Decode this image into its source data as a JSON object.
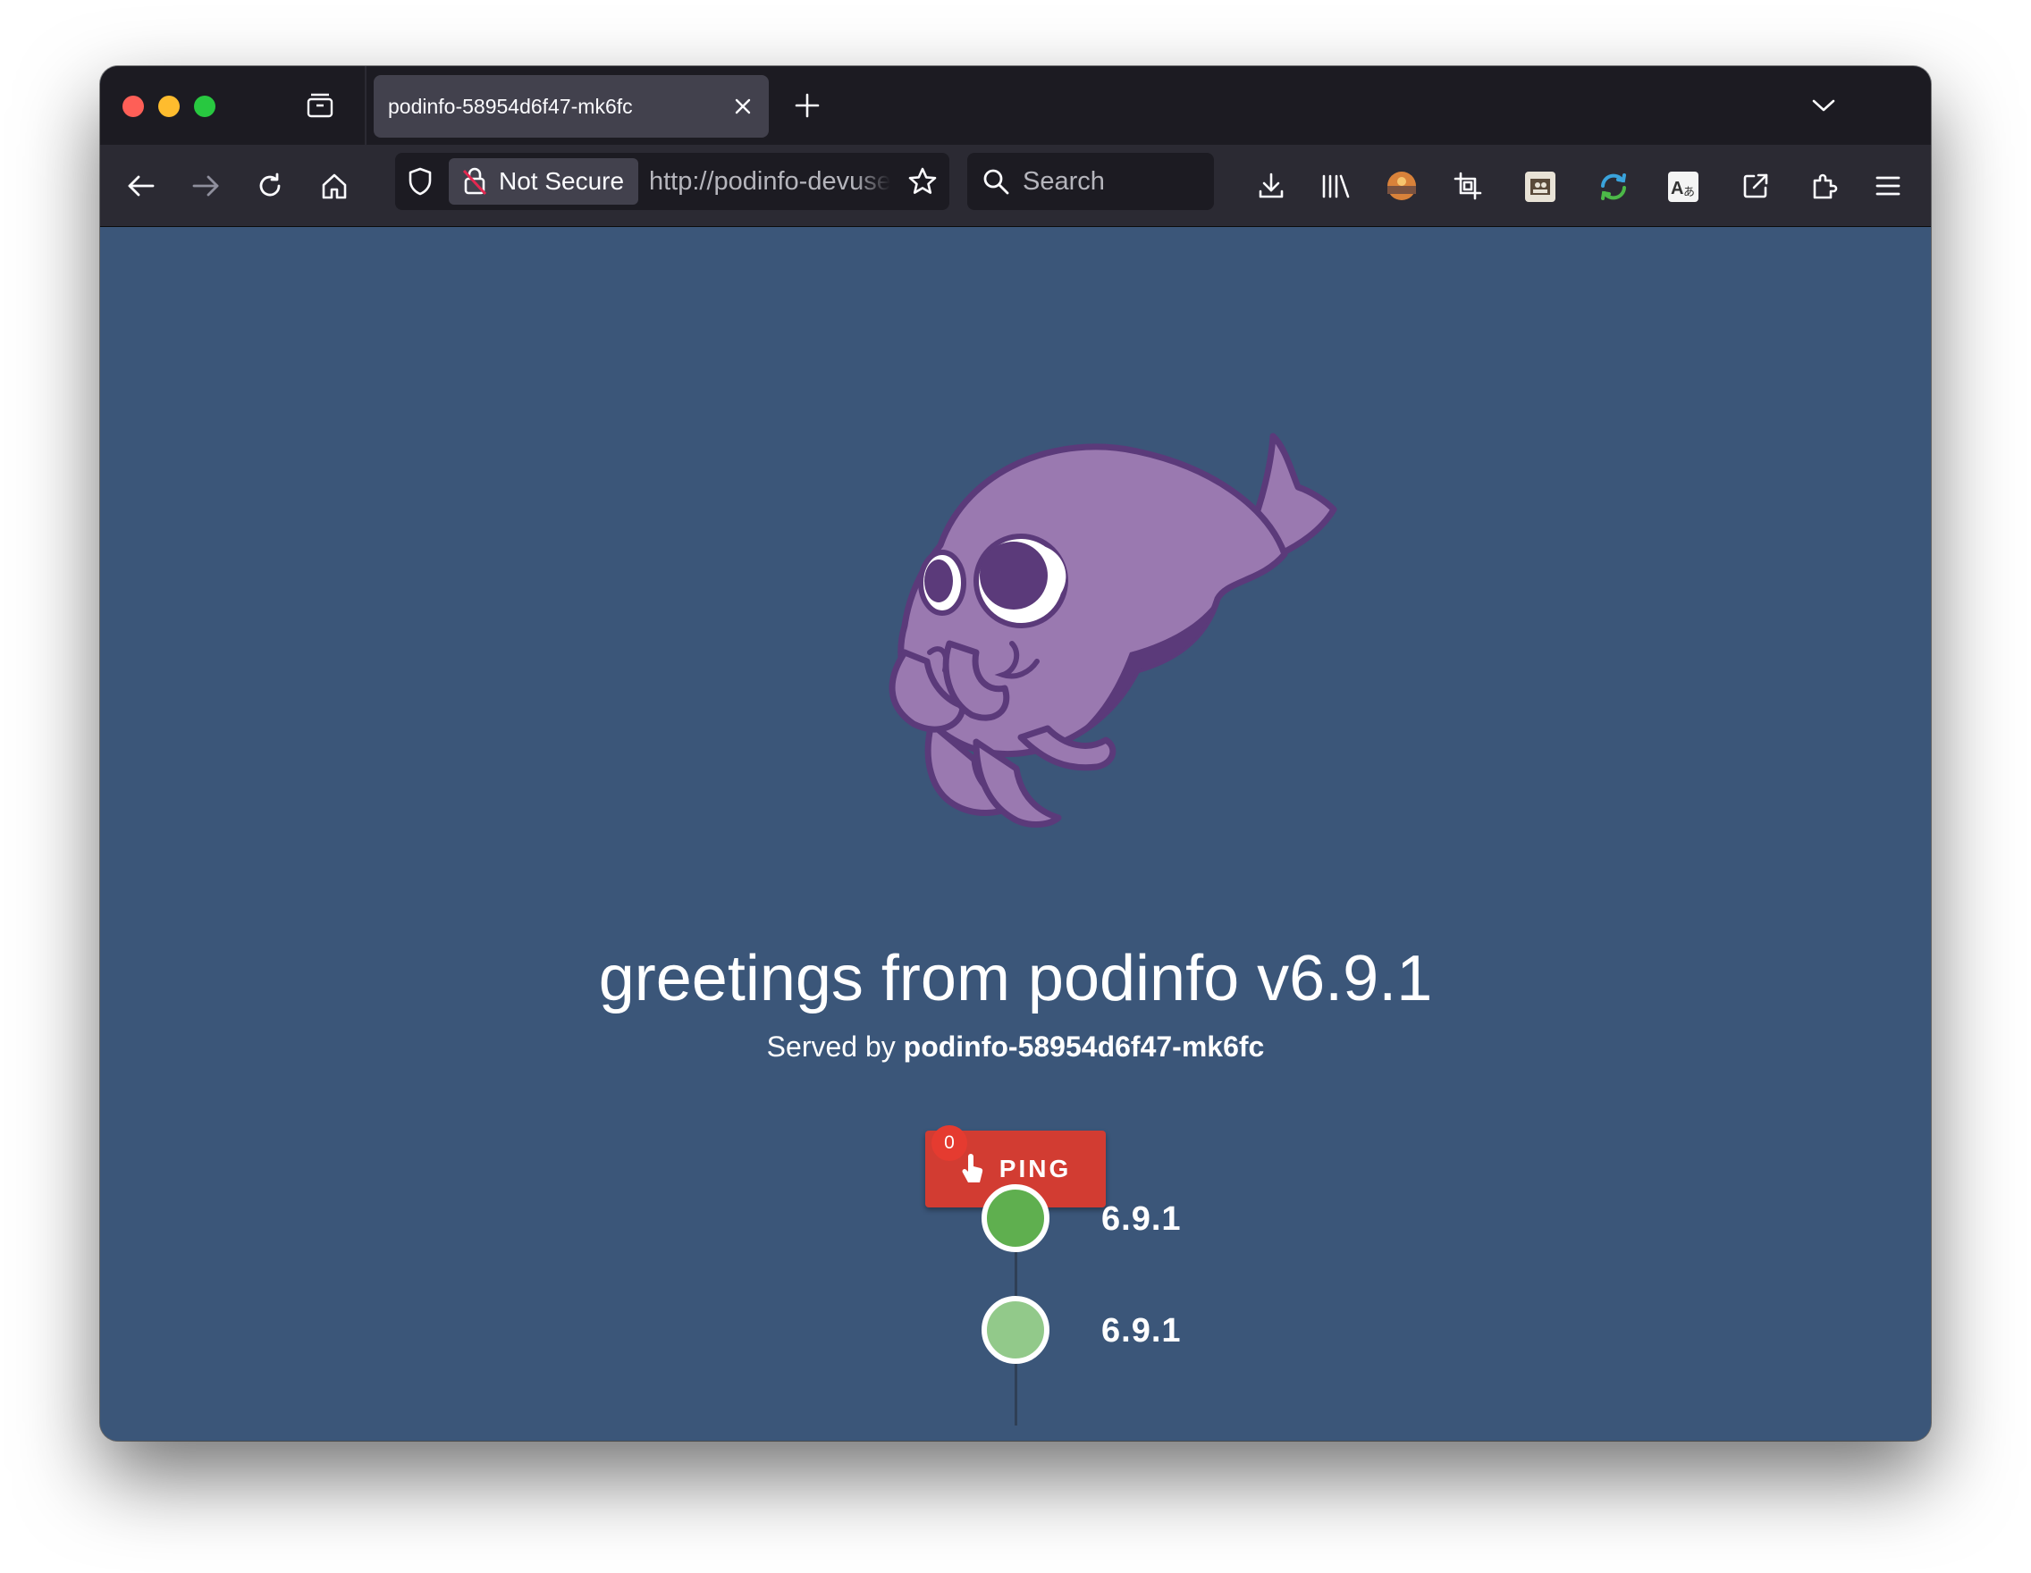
{
  "browser": {
    "tab": {
      "title": "podinfo-58954d6f47-mk6fc"
    },
    "url": {
      "security_label": "Not Secure",
      "address": "http://podinfo-devuse"
    },
    "search": {
      "placeholder": "Search"
    }
  },
  "page": {
    "headline": "greetings from podinfo v6.9.1",
    "served_prefix": "Served by",
    "served_host": "podinfo-58954d6f47-mk6fc",
    "ping": {
      "label": "PING",
      "count": "0"
    },
    "timeline": [
      {
        "version": "6.9.1",
        "color": "#5faf4f"
      },
      {
        "version": "6.9.1",
        "color": "#92c98a"
      }
    ]
  },
  "colors": {
    "page_background": "#3b5679",
    "ping_button": "#d23c32",
    "mascot_body": "#9a79b0",
    "mascot_outline": "#5b3a7a"
  }
}
